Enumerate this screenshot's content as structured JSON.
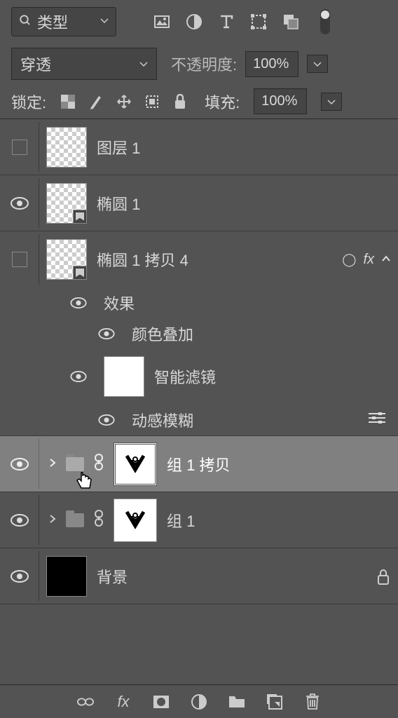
{
  "filter": {
    "type_label": "类型"
  },
  "blend": {
    "mode": "穿透",
    "opacity_label": "不透明度:",
    "opacity_value": "100%"
  },
  "lock": {
    "label": "锁定:",
    "fill_label": "填充:",
    "fill_value": "100%"
  },
  "layers": [
    {
      "name": "图层 1",
      "visible": false,
      "thumb": "checker"
    },
    {
      "name": "椭圆 1",
      "visible": true,
      "thumb": "checker-smart"
    },
    {
      "name": "椭圆 1 拷贝 4",
      "visible": false,
      "thumb": "checker-smart",
      "fx": true,
      "expanded": true
    },
    {
      "name": "组 1 拷贝",
      "visible": true,
      "thumb": "so",
      "selected": true,
      "group": true
    },
    {
      "name": "组 1",
      "visible": true,
      "thumb": "so",
      "group": true
    },
    {
      "name": "背景",
      "visible": true,
      "thumb": "black",
      "locked": true
    }
  ],
  "effects": {
    "label": "效果",
    "color_overlay": "颜色叠加",
    "smart_filters": "智能滤镜",
    "motion_blur": "动感模糊"
  },
  "icons": {
    "fx": "fx",
    "circle": "◯"
  }
}
